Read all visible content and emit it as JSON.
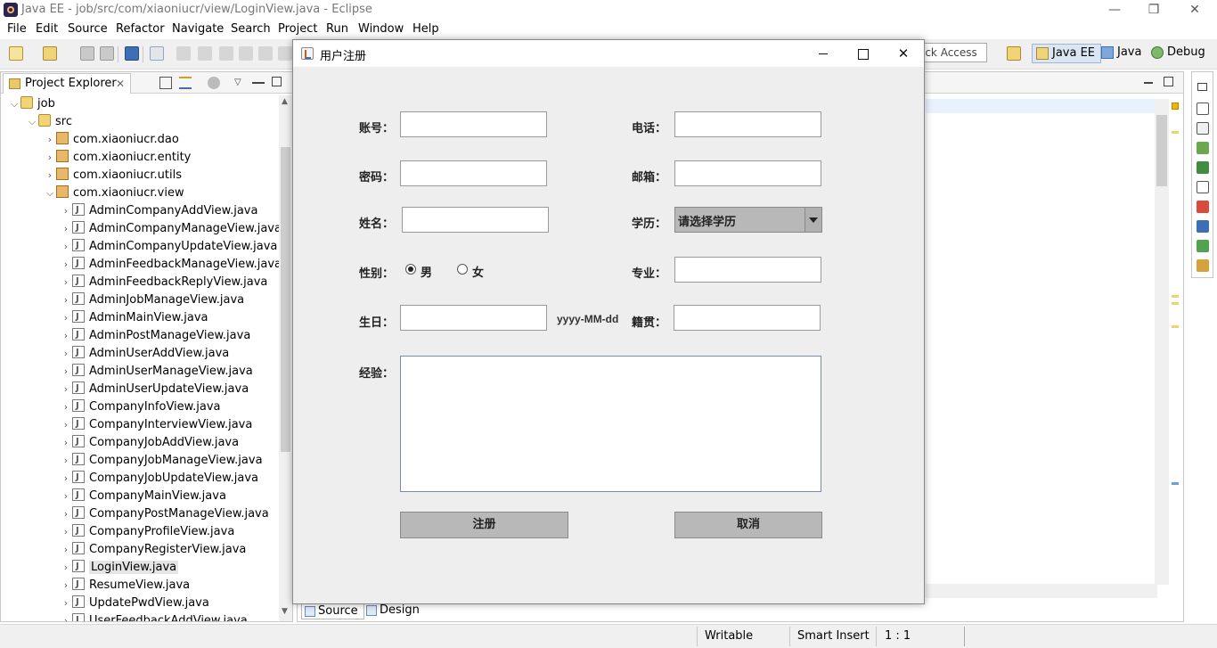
{
  "window": {
    "title": "Java EE - job/src/com/xiaoniucr/view/LoginView.java - Eclipse",
    "controls": {
      "minimize": "—",
      "restore": "❐",
      "close": "✕"
    }
  },
  "menubar": [
    "File",
    "Edit",
    "Source",
    "Refactor",
    "Navigate",
    "Search",
    "Project",
    "Run",
    "Window",
    "Help"
  ],
  "toolbar": {
    "quick_access": "ick Access",
    "perspectives": [
      "Java EE",
      "Java",
      "Debug"
    ]
  },
  "project_explorer": {
    "tab_label": "Project Explorer",
    "tab_close": "✕",
    "tree": {
      "project": "job",
      "src_folder": "src",
      "packages": [
        "com.xiaoniucr.dao",
        "com.xiaoniucr.entity",
        "com.xiaoniucr.utils",
        "com.xiaoniucr.view"
      ],
      "files": [
        "AdminCompanyAddView.java",
        "AdminCompanyManageView.java",
        "AdminCompanyUpdateView.java",
        "AdminFeedbackManageView.java",
        "AdminFeedbackReplyView.java",
        "AdminJobManageView.java",
        "AdminMainView.java",
        "AdminPostManageView.java",
        "AdminUserAddView.java",
        "AdminUserManageView.java",
        "AdminUserUpdateView.java",
        "CompanyInfoView.java",
        "CompanyInterviewView.java",
        "CompanyJobAddView.java",
        "CompanyJobManageView.java",
        "CompanyJobUpdateView.java",
        "CompanyMainView.java",
        "CompanyPostManageView.java",
        "CompanyProfileView.java",
        "CompanyRegisterView.java",
        "LoginView.java",
        "ResumeView.java",
        "UpdatePwdView.java",
        "UserFeedbackAddView.java"
      ],
      "selected_file": "LoginView.java"
    }
  },
  "editor": {
    "bottom_tabs": [
      "Source",
      "Design"
    ],
    "active_bottom_tab": "Source"
  },
  "statusbar": {
    "writable": "Writable",
    "insert_mode": "Smart Insert",
    "position": "1 : 1"
  },
  "dialog": {
    "title": "用户注册",
    "labels": {
      "account": "账号：",
      "password": "密码：",
      "name": "姓名：",
      "gender": "性别：",
      "birthday": "生日：",
      "experience": "经验：",
      "phone": "电话：",
      "email": "邮箱：",
      "education": "学历：",
      "major": "专业：",
      "native_place": "籍贯："
    },
    "gender_options": [
      "男",
      "女"
    ],
    "gender_selected": "男",
    "date_hint": "yyyy-MM-dd",
    "education_select": "请选择学历",
    "register_button": "注册",
    "cancel_button": "取消"
  }
}
